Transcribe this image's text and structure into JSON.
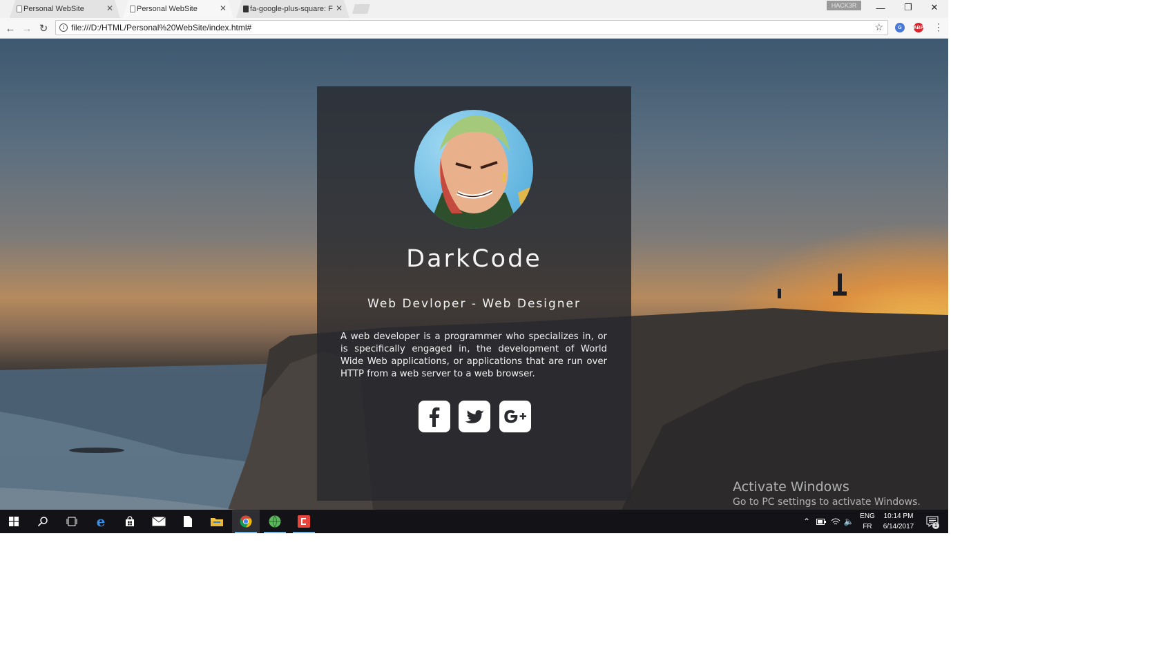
{
  "browser": {
    "tabs": [
      {
        "title": "Personal WebSite",
        "active": false
      },
      {
        "title": "Personal WebSite",
        "active": true
      },
      {
        "title": "fa-google-plus-square: F",
        "active": false
      }
    ],
    "profile_label": "HACK3R",
    "url": "file:///D:/HTML/Personal%20WebSite/index.html#",
    "icons": {
      "back": "arrow-left-icon",
      "forward": "arrow-right-icon",
      "reload": "reload-icon",
      "bookmark": "star-icon",
      "menu": "more-vert-icon"
    }
  },
  "page": {
    "brand": "DarkCode",
    "tagline": "Web Devloper - Web Designer",
    "bio": "A web developer is a programmer who specializes in, or is specifically engaged in, the development of World Wide Web applications, or applications that are run over HTTP from a web server to a web browser.",
    "social": [
      {
        "name": "facebook-icon",
        "glyph": "f"
      },
      {
        "name": "twitter-icon",
        "glyph": "t"
      },
      {
        "name": "google-plus-icon",
        "glyph": "G+"
      }
    ]
  },
  "os": {
    "watermark_title": "Activate Windows",
    "watermark_sub": "Go to PC settings to activate Windows.",
    "language": "ENG",
    "keyboard": "FR",
    "time": "10:14 PM",
    "date": "6/14/2017",
    "notification_count": "1"
  },
  "colors": {
    "card": "#2a2c30",
    "taskbar_accent": "#76b9ed",
    "chrome_red": "#db4437",
    "chrome_yellow": "#f4b400",
    "chrome_green": "#0f9d58"
  }
}
